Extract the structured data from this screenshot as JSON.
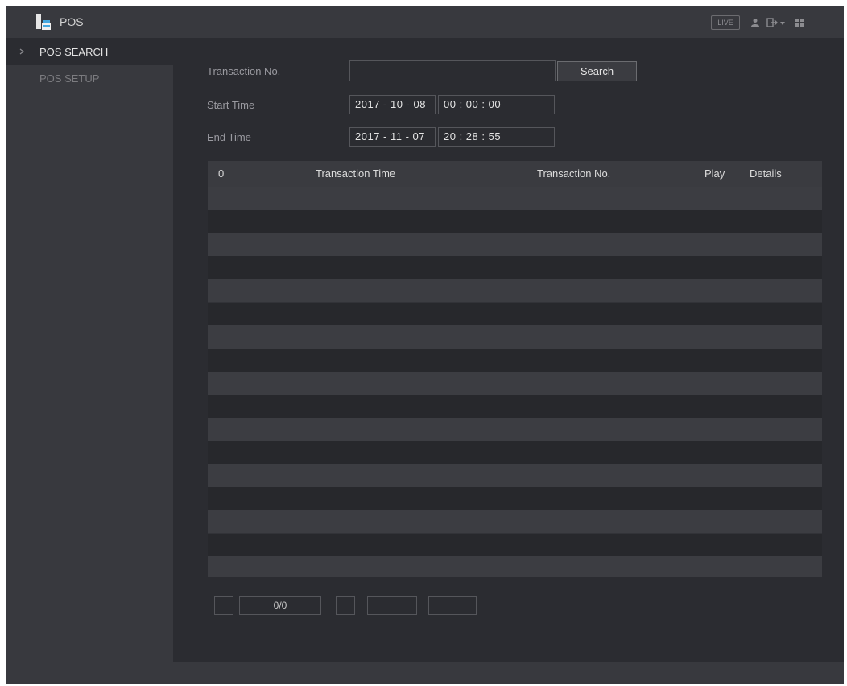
{
  "titlebar": {
    "title": "POS",
    "live_label": "LIVE"
  },
  "sidebar": {
    "items": [
      {
        "label": "POS SEARCH",
        "active": true
      },
      {
        "label": "POS SETUP",
        "active": false
      }
    ]
  },
  "search": {
    "transaction_label": "Transaction No.",
    "transaction_value": "",
    "search_button": "Search",
    "start_label": "Start Time",
    "start_date": "2017 - 10 - 08",
    "start_time": "00 : 00 : 00",
    "end_label": "End Time",
    "end_date": "2017 - 11 - 07",
    "end_time": "20 : 28 : 55"
  },
  "table": {
    "columns": [
      "0",
      "Transaction Time",
      "Transaction No.",
      "Play",
      "Details"
    ],
    "rows": []
  },
  "pager": {
    "page": "0/0",
    "go_label": ""
  },
  "colors": {
    "background": "#2b2c31",
    "panel": "#38393e",
    "text": "#e4e4e4",
    "muted_text": "#9a9aa0"
  }
}
